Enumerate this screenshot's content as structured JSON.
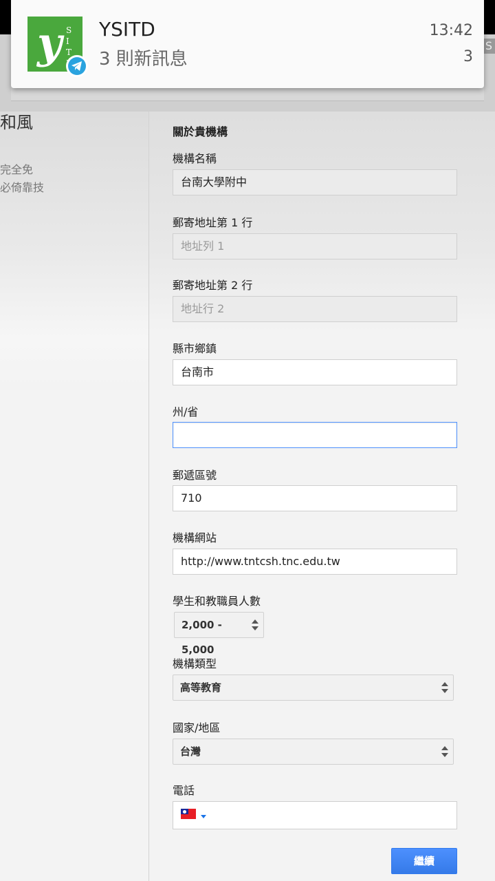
{
  "notification": {
    "app": "YSITD",
    "message": "3 則新訊息",
    "time": "13:42",
    "count": "3",
    "icon_letter": "y",
    "icon_side_letters": "S\nI\nT\nD",
    "badge_icon": "telegram-icon"
  },
  "appbar": {
    "right_edge_text": "S"
  },
  "left": {
    "title": "和風",
    "line1": "完全免",
    "line2": "必倚靠技"
  },
  "form": {
    "section_title": "關於貴機構",
    "org_name": {
      "label": "機構名稱",
      "value": "台南大學附中"
    },
    "address1": {
      "label": "郵寄地址第 1 行",
      "placeholder": "地址列 1"
    },
    "address2": {
      "label": "郵寄地址第 2 行",
      "placeholder": "地址行 2"
    },
    "city": {
      "label": "縣市鄉鎮",
      "value": "台南市"
    },
    "state": {
      "label": "州/省",
      "value": ""
    },
    "postal": {
      "label": "郵遞區號",
      "value": "710"
    },
    "website": {
      "label": "機構網站",
      "value": "http://www.tntcsh.tnc.edu.tw"
    },
    "size": {
      "label": "學生和教職員人數",
      "value": "2,000 - 5,000"
    },
    "org_type": {
      "label": "機構類型",
      "value": "高等教育"
    },
    "country": {
      "label": "國家/地區",
      "value": "台灣"
    },
    "phone": {
      "label": "電話",
      "flag": "taiwan-flag-icon",
      "value": ""
    },
    "submit_label": "繼續"
  },
  "colors": {
    "accent": "#4d90fe",
    "icon_green": "#4aa83d",
    "telegram": "#2aa3df"
  }
}
